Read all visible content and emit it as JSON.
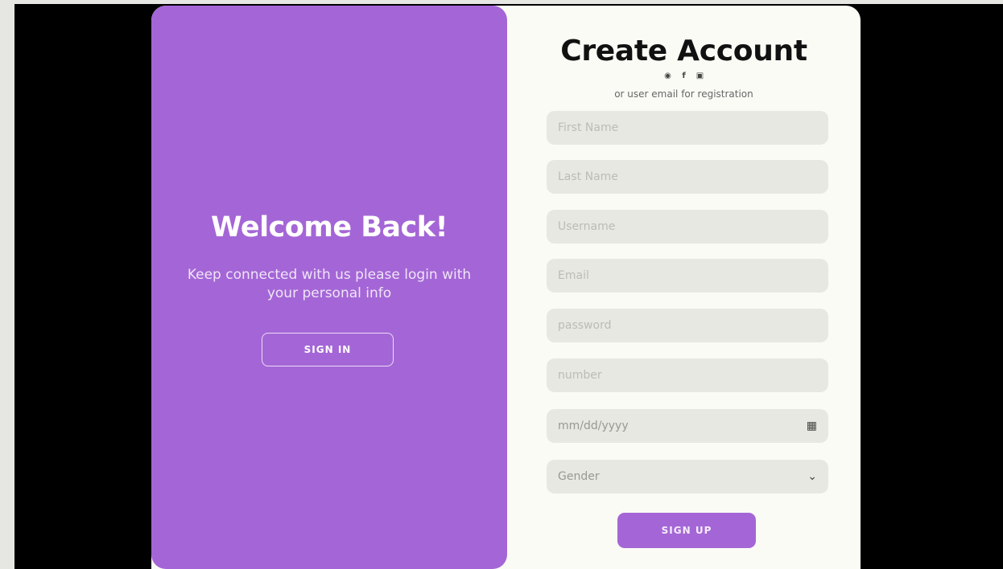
{
  "colors": {
    "accent": "#a466d6",
    "panel_bg": "#fbfbf6",
    "field_bg": "#e8e8e3",
    "backdrop": "#000000"
  },
  "overlay": {
    "title": "Welcome Back!",
    "text": "Keep connected with us please login with your personal info",
    "sign_in_label": "SIGN IN"
  },
  "form": {
    "title": "Create Account",
    "social_icons": [
      "google-icon",
      "facebook-icon",
      "instagram-icon"
    ],
    "subtitle": "or user email for registration",
    "fields": {
      "first_name": {
        "placeholder": "First Name"
      },
      "last_name": {
        "placeholder": "Last Name"
      },
      "username": {
        "placeholder": "Username"
      },
      "email": {
        "placeholder": "Email"
      },
      "password": {
        "placeholder": "password"
      },
      "number": {
        "placeholder": "number"
      },
      "dob": {
        "value": "mm/dd/yyyy"
      },
      "gender": {
        "selected": "Gender"
      }
    },
    "sign_up_label": "SIGN UP"
  }
}
